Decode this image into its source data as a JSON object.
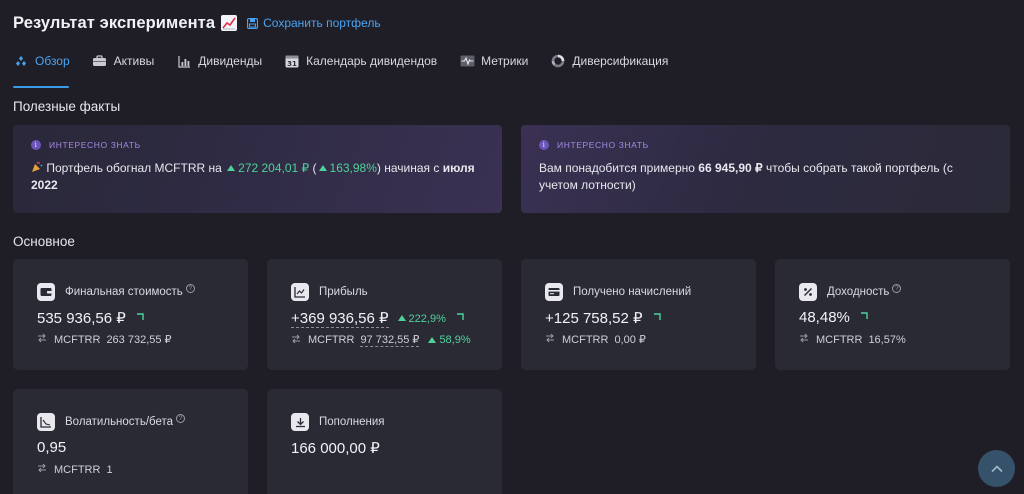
{
  "header": {
    "title": "Результат эксперимента",
    "title_icon": "chart-increasing-emoji",
    "save_label": "Сохранить портфель"
  },
  "tabs": [
    {
      "label": "Обзор",
      "icon": "overview-icon",
      "active": true
    },
    {
      "label": "Активы",
      "icon": "briefcase-icon"
    },
    {
      "label": "Дивиденды",
      "icon": "bar-chart-icon"
    },
    {
      "label": "Календарь дивидендов",
      "icon": "calendar-icon",
      "icon_text": "31"
    },
    {
      "label": "Метрики",
      "icon": "pulse-icon"
    },
    {
      "label": "Диверсификация",
      "icon": "donut-icon"
    }
  ],
  "facts_section": {
    "title": "Полезные факты",
    "cards": [
      {
        "badge": "ИНТЕРЕСНО ЗНАТЬ",
        "emoji": "party-popper",
        "t1": "Портфель обогнал MCFTRR на ",
        "v1": "272 204,01 ₽",
        "t2": " (",
        "v2": "163,98%",
        "t3": ") начиная с ",
        "b1": "июля 2022"
      },
      {
        "badge": "ИНТЕРЕСНО ЗНАТЬ",
        "t1": "Вам понадобится примерно ",
        "b1": "66 945,90 ₽",
        "t2": " чтобы собрать такой портфель (с учетом лотности)"
      }
    ]
  },
  "main_section": {
    "title": "Основное",
    "cards": [
      {
        "label": "Финальная стоимость",
        "help": "?",
        "value": "535 936,56 ₽",
        "bench_name": "MCFTRR",
        "bench_value": "263 732,55 ₽"
      },
      {
        "label": "Прибыль",
        "value": "+369 936,56 ₽",
        "change": "222,9%",
        "bench_name": "MCFTRR",
        "bench_value": "97 732,55 ₽",
        "bench_change": "58,9%"
      },
      {
        "label": "Получено начислений",
        "value": "+125 758,52 ₽",
        "bench_name": "MCFTRR",
        "bench_value": "0,00 ₽"
      },
      {
        "label": "Доходность",
        "help": "?",
        "value": "48,48%",
        "bench_name": "MCFTRR",
        "bench_value": "16,57%"
      },
      {
        "label": "Волатильность/бета",
        "help": "?",
        "value": "0,95",
        "bench_name": "MCFTRR",
        "bench_value": "1"
      },
      {
        "label": "Пополнения",
        "value": "166 000,00 ₽"
      }
    ]
  },
  "colors": {
    "background": "#1f1e27",
    "card": "#2a2a35",
    "accent": "#4aa3f0",
    "positive": "#4fd19a",
    "badge": "#a48ae6"
  }
}
